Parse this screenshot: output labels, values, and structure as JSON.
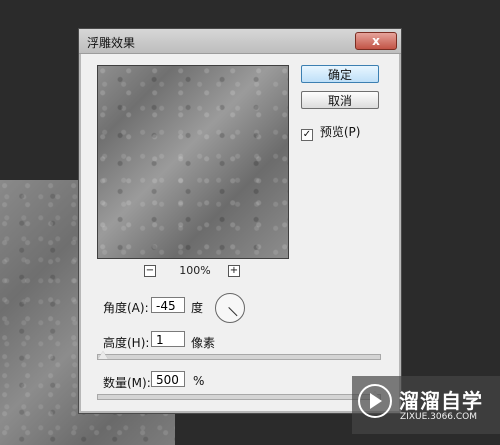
{
  "dialog": {
    "title": "浮雕效果",
    "close_symbol": "x",
    "buttons": {
      "ok": "确定",
      "cancel": "取消"
    },
    "preview_checkbox": {
      "label": "预览(P)",
      "checked": true
    },
    "zoom": {
      "minus": "−",
      "value": "100%",
      "plus": "+"
    },
    "fields": {
      "angle": {
        "label": "角度(A):",
        "value": "-45",
        "unit": "度"
      },
      "height": {
        "label": "高度(H):",
        "value": "1",
        "unit": "像素"
      },
      "amount": {
        "label": "数量(M):",
        "value": "500",
        "unit": "%"
      }
    }
  },
  "watermark": {
    "title": "溜溜自学",
    "url": "ZIXUE.3066.COM"
  },
  "colors": {
    "background": "#2b2b2b",
    "dialog": "#f0f0f0",
    "accent": "#3c7fb1",
    "close": "#c25446"
  }
}
